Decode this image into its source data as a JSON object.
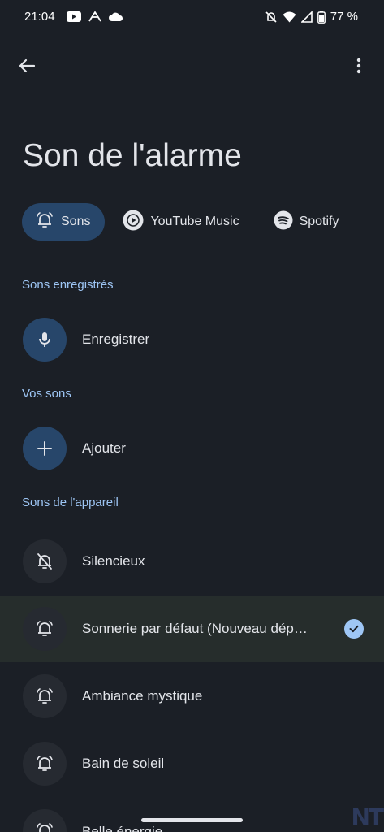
{
  "status_bar": {
    "time": "21:04",
    "battery": "77 %",
    "left_icons": [
      "youtube-icon",
      "signal-app-icon",
      "cloud-icon"
    ],
    "right_icons": [
      "bell-off-icon",
      "wifi-icon",
      "cell-signal-icon",
      "battery-icon"
    ]
  },
  "header": {
    "back_icon": "arrow-back-icon",
    "menu_icon": "more-vert-icon",
    "title": "Son de l'alarme"
  },
  "tabs": [
    {
      "label": "Sons",
      "icon": "bell-icon",
      "selected": true
    },
    {
      "label": "YouTube Music",
      "icon": "youtube-music-icon",
      "selected": false
    },
    {
      "label": "Spotify",
      "icon": "spotify-icon",
      "selected": false
    }
  ],
  "sections": {
    "recorded": {
      "title": "Sons enregistrés",
      "item": {
        "label": "Enregistrer",
        "icon": "mic-icon"
      }
    },
    "yours": {
      "title": "Vos sons",
      "item": {
        "label": "Ajouter",
        "icon": "plus-icon"
      }
    },
    "device": {
      "title": "Sons de l'appareil",
      "items": [
        {
          "label": "Silencieux",
          "icon": "bell-off-icon",
          "selected": false
        },
        {
          "label": "Sonnerie par défaut (Nouveau dép…",
          "icon": "bell-icon",
          "selected": true
        },
        {
          "label": "Ambiance mystique",
          "icon": "bell-icon",
          "selected": false
        },
        {
          "label": "Bain de soleil",
          "icon": "bell-icon",
          "selected": false
        },
        {
          "label": "Belle énergie",
          "icon": "bell-icon",
          "selected": false
        }
      ]
    }
  },
  "colors": {
    "background": "#1b1f26",
    "accent": "#9ec6f5",
    "chip_selected": "#27466a",
    "row_selected": "#262d2c"
  },
  "watermark": "NT"
}
